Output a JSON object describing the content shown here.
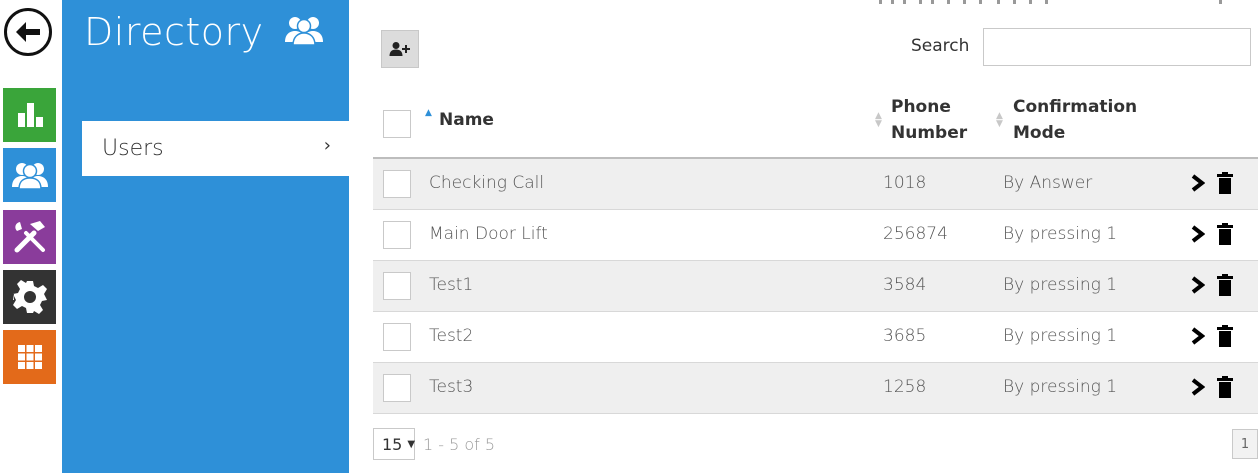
{
  "panel": {
    "title": "Directory",
    "users_label": "Users",
    "users_chevron": "›"
  },
  "toolbar": {
    "search_label": "Search",
    "search_value": "",
    "add_user_icon": "add-user-icon"
  },
  "table": {
    "columns": {
      "name": "Name",
      "phone_line1": "Phone",
      "phone_line2": "Number",
      "mode_line1": "Confirmation",
      "mode_line2": "Mode"
    },
    "rows": [
      {
        "name": "Checking Call",
        "phone": "1018",
        "mode": "By Answer"
      },
      {
        "name": "Main Door Lift",
        "phone": "256874",
        "mode": "By pressing 1"
      },
      {
        "name": "Test1",
        "phone": "3584",
        "mode": "By pressing 1"
      },
      {
        "name": "Test2",
        "phone": "3685",
        "mode": "By pressing 1"
      },
      {
        "name": "Test3",
        "phone": "1258",
        "mode": "By pressing 1"
      }
    ]
  },
  "footer": {
    "page_size": "15",
    "range": "1 - 5 of 5",
    "page": "1"
  },
  "colors": {
    "blue": "#2e90d8",
    "green": "#3aa53a",
    "purple": "#8a3c9b",
    "dark": "#333333",
    "orange": "#e36a1a"
  }
}
